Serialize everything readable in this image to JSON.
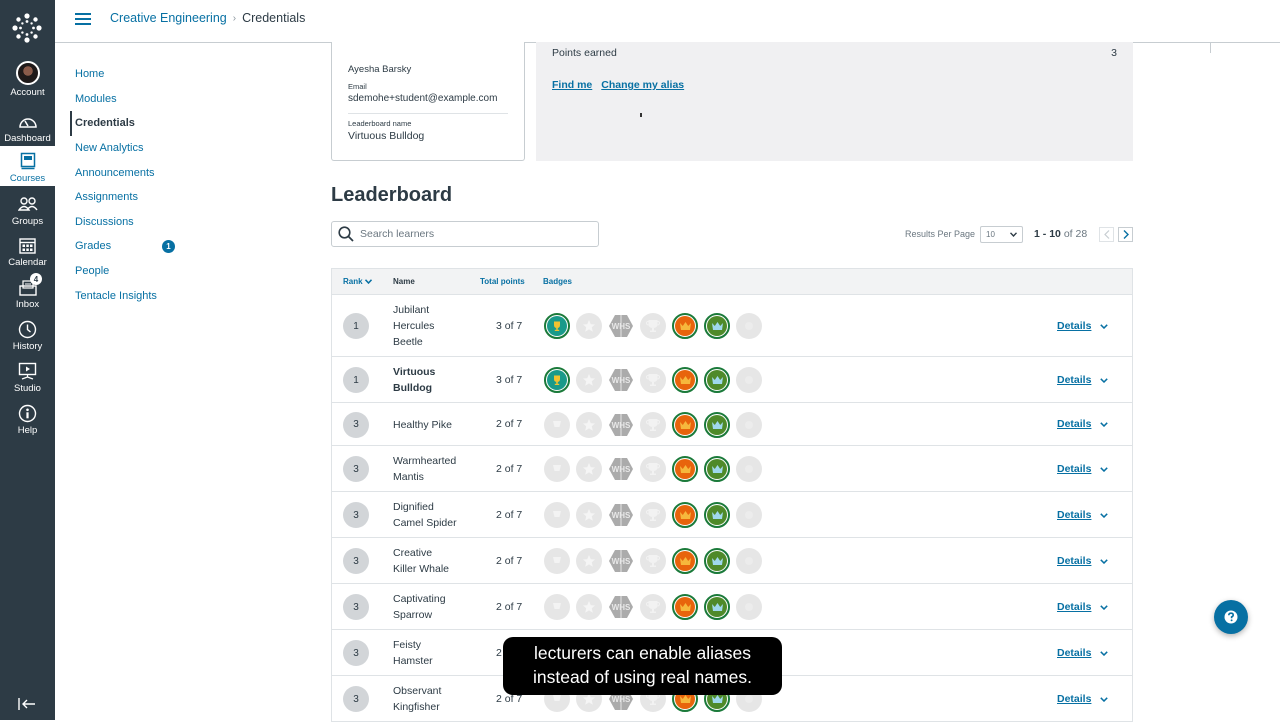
{
  "global_nav": {
    "items": [
      {
        "id": "account",
        "label": "Account",
        "icon": "avatar"
      },
      {
        "id": "dashboard",
        "label": "Dashboard",
        "icon": "dashboard-icon"
      },
      {
        "id": "courses",
        "label": "Courses",
        "icon": "courses-icon",
        "active": true
      },
      {
        "id": "groups",
        "label": "Groups",
        "icon": "groups-icon"
      },
      {
        "id": "calendar",
        "label": "Calendar",
        "icon": "calendar-icon"
      },
      {
        "id": "inbox",
        "label": "Inbox",
        "icon": "inbox-icon",
        "badge": "4"
      },
      {
        "id": "history",
        "label": "History",
        "icon": "clock-icon"
      },
      {
        "id": "studio",
        "label": "Studio",
        "icon": "studio-icon"
      },
      {
        "id": "help",
        "label": "Help",
        "icon": "help-icon"
      }
    ]
  },
  "header": {
    "course": "Creative Engineering",
    "separator": "›",
    "current": "Credentials"
  },
  "course_nav": {
    "items": [
      {
        "label": "Home"
      },
      {
        "label": "Modules"
      },
      {
        "label": "Credentials",
        "active": true
      },
      {
        "label": "New Analytics"
      },
      {
        "label": "Announcements"
      },
      {
        "label": "Assignments"
      },
      {
        "label": "Discussions"
      },
      {
        "label": "Grades",
        "badge": "1"
      },
      {
        "label": "People"
      },
      {
        "label": "Tentacle Insights"
      }
    ]
  },
  "profile": {
    "name": "Ayesha Barsky",
    "email_label": "Email",
    "email": "sdemohe+student@example.com",
    "leaderboard_label": "Leaderboard name",
    "leaderboard_name": "Virtuous Bulldog"
  },
  "points": {
    "label": "Points earned",
    "value": "3",
    "find_me": "Find me",
    "change_alias": "Change my alias"
  },
  "leaderboard": {
    "title": "Leaderboard",
    "search_placeholder": "Search learners",
    "results_per_page_label": "Results Per Page",
    "results_per_page": "10",
    "range_start_end": "1 - 10",
    "range_of": "of 28",
    "columns": {
      "rank": "Rank",
      "name": "Name",
      "points": "Total points",
      "badges": "Badges"
    },
    "details_label": "Details",
    "badge_types": [
      {
        "id": "trophy-teal",
        "icon": "trophy-icon",
        "color": "#1a9a8a"
      },
      {
        "id": "star",
        "icon": "star-icon",
        "color": "#d6d6d6"
      },
      {
        "id": "whs",
        "icon": "whs-hexagon-icon",
        "text": "WHS",
        "color": "#a8a8a8"
      },
      {
        "id": "cup",
        "icon": "cup-icon",
        "color": "#d0d0d0"
      },
      {
        "id": "crown-orange",
        "icon": "crown-icon",
        "color": "#e8640c"
      },
      {
        "id": "crown-green",
        "icon": "crown-icon",
        "color": "#4f8a2a"
      },
      {
        "id": "medal",
        "icon": "medal-icon",
        "color": "#e0e0e0"
      }
    ],
    "rows": [
      {
        "rank": "1",
        "name_lines": [
          "Jubilant",
          "Hercules",
          "Beetle"
        ],
        "points": "3 of 7",
        "earned": [
          true,
          false,
          false,
          false,
          true,
          true,
          false
        ],
        "me": false
      },
      {
        "rank": "1",
        "name_lines": [
          "Virtuous",
          "Bulldog"
        ],
        "points": "3 of 7",
        "earned": [
          true,
          false,
          false,
          false,
          true,
          true,
          false
        ],
        "me": true
      },
      {
        "rank": "3",
        "name_lines": [
          "Healthy Pike"
        ],
        "points": "2 of 7",
        "earned": [
          false,
          false,
          false,
          false,
          true,
          true,
          false
        ],
        "me": false
      },
      {
        "rank": "3",
        "name_lines": [
          "Warmhearted",
          "Mantis"
        ],
        "points": "2 of 7",
        "earned": [
          false,
          false,
          false,
          false,
          true,
          true,
          false
        ],
        "me": false
      },
      {
        "rank": "3",
        "name_lines": [
          "Dignified",
          "Camel Spider"
        ],
        "points": "2 of 7",
        "earned": [
          false,
          false,
          false,
          false,
          true,
          true,
          false
        ],
        "me": false
      },
      {
        "rank": "3",
        "name_lines": [
          "Creative",
          "Killer Whale"
        ],
        "points": "2 of 7",
        "earned": [
          false,
          false,
          false,
          false,
          true,
          true,
          false
        ],
        "me": false
      },
      {
        "rank": "3",
        "name_lines": [
          "Captivating",
          "Sparrow"
        ],
        "points": "2 of 7",
        "earned": [
          false,
          false,
          false,
          false,
          true,
          true,
          false
        ],
        "me": false
      },
      {
        "rank": "3",
        "name_lines": [
          "Feisty",
          "Hamster"
        ],
        "points": "2 of 7",
        "earned": [
          false,
          false,
          false,
          false,
          true,
          true,
          false
        ],
        "me": false
      },
      {
        "rank": "3",
        "name_lines": [
          "Observant",
          "Kingfisher"
        ],
        "points": "2 of 7",
        "earned": [
          false,
          false,
          false,
          false,
          true,
          true,
          false
        ],
        "me": false
      }
    ]
  },
  "caption": {
    "line1": "lecturers can enable aliases",
    "line2": "instead of using real names."
  },
  "colors": {
    "nav_bg": "#2d3b45",
    "link": "#0770a3",
    "earned_ring": "#1b7a3a"
  }
}
